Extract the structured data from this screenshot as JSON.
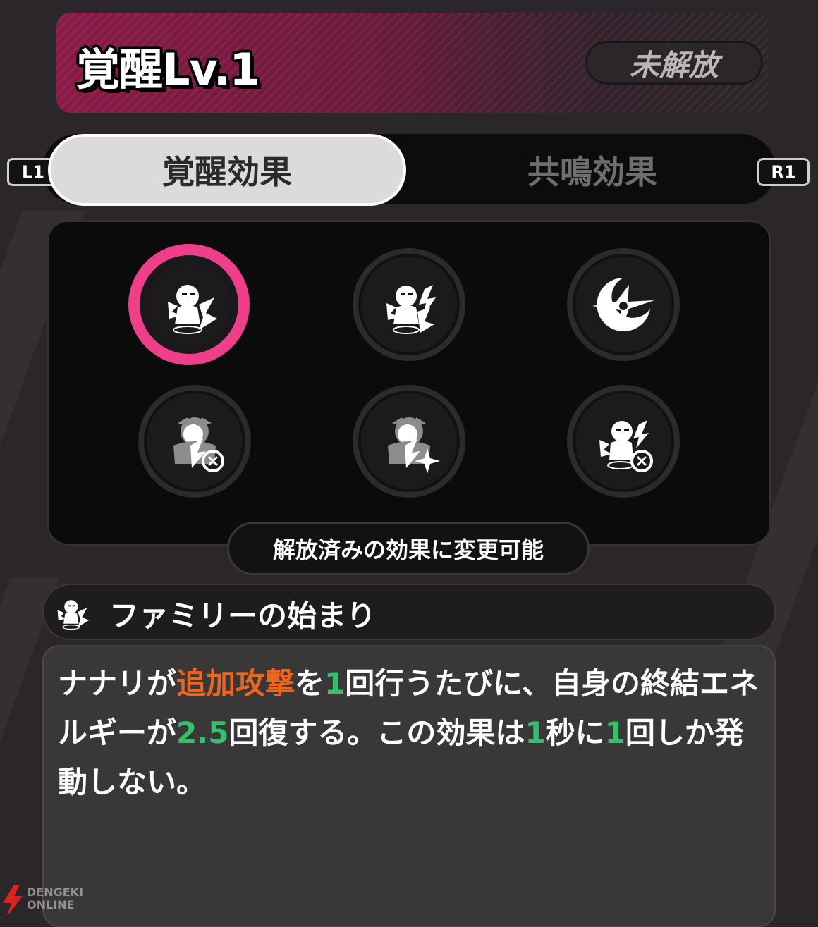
{
  "header": {
    "title": "覚醒Lv.1",
    "status": "未解放"
  },
  "tabs": {
    "left_key": "L1",
    "right_key": "R1",
    "active_label": "覚醒効果",
    "inactive_label": "共鳴効果"
  },
  "grid": {
    "icons": [
      {
        "name": "follow-up-attack-icon",
        "selected": true
      },
      {
        "name": "lightning-attack-icon",
        "selected": false
      },
      {
        "name": "shuriken-crescent-icon",
        "selected": false
      },
      {
        "name": "timer-attack-icon",
        "selected": false
      },
      {
        "name": "star-attack-icon",
        "selected": false
      },
      {
        "name": "lightning-timer-icon",
        "selected": false
      }
    ],
    "hint": "解放済みの効果に変更可能"
  },
  "skill": {
    "icon": "follow-up-attack-icon",
    "name": "ファミリーの始まり"
  },
  "description": {
    "p1": "ナナリが",
    "h1": "追加攻撃",
    "p2": "を",
    "n1": "1",
    "p3": "回行うたびに、自身の終結エネルギーが",
    "n2": "2.5",
    "p4": "回復する。この効果は",
    "n3": "1",
    "p5": "秒に",
    "n4": "1",
    "p6": "回しか発動しない。"
  },
  "watermark": {
    "line1": "DENGEKI",
    "line2": "ONLINE"
  },
  "colors": {
    "accent_pink": "#ef3e8a",
    "highlight_orange": "#f0651e",
    "highlight_green": "#35c06b"
  }
}
